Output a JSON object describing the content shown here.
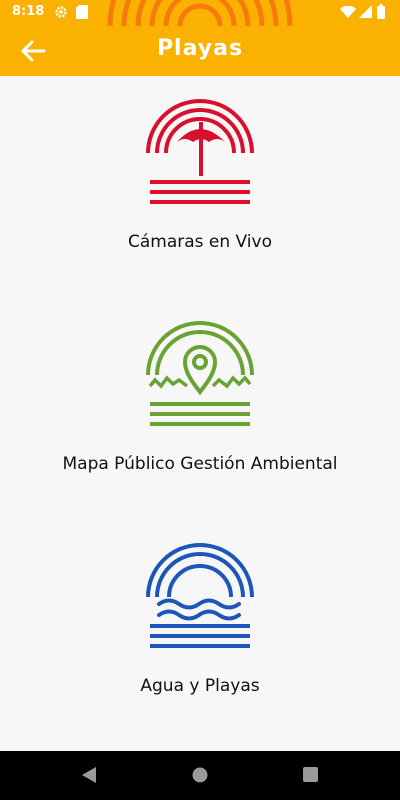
{
  "status_bar": {
    "time": "8:18",
    "icons": [
      "gear-icon",
      "sd-card-icon",
      "wifi-icon",
      "cellular-signal-icon",
      "battery-icon"
    ]
  },
  "app_bar": {
    "title": "Playas",
    "back_icon": "arrow-back-icon",
    "color": "#fbb100"
  },
  "items": [
    {
      "label": "Cámaras en Vivo",
      "icon": "beach-umbrella-icon",
      "color": "#d8102c"
    },
    {
      "label": "Mapa Público Gestión Ambiental",
      "icon": "map-pin-landscape-icon",
      "color": "#6aa334"
    },
    {
      "label": "Agua y Playas",
      "icon": "sun-water-waves-icon",
      "color": "#1c56b8"
    }
  ],
  "nav_bar": {
    "buttons": [
      "back-triangle-icon",
      "home-circle-icon",
      "recents-square-icon"
    ]
  }
}
